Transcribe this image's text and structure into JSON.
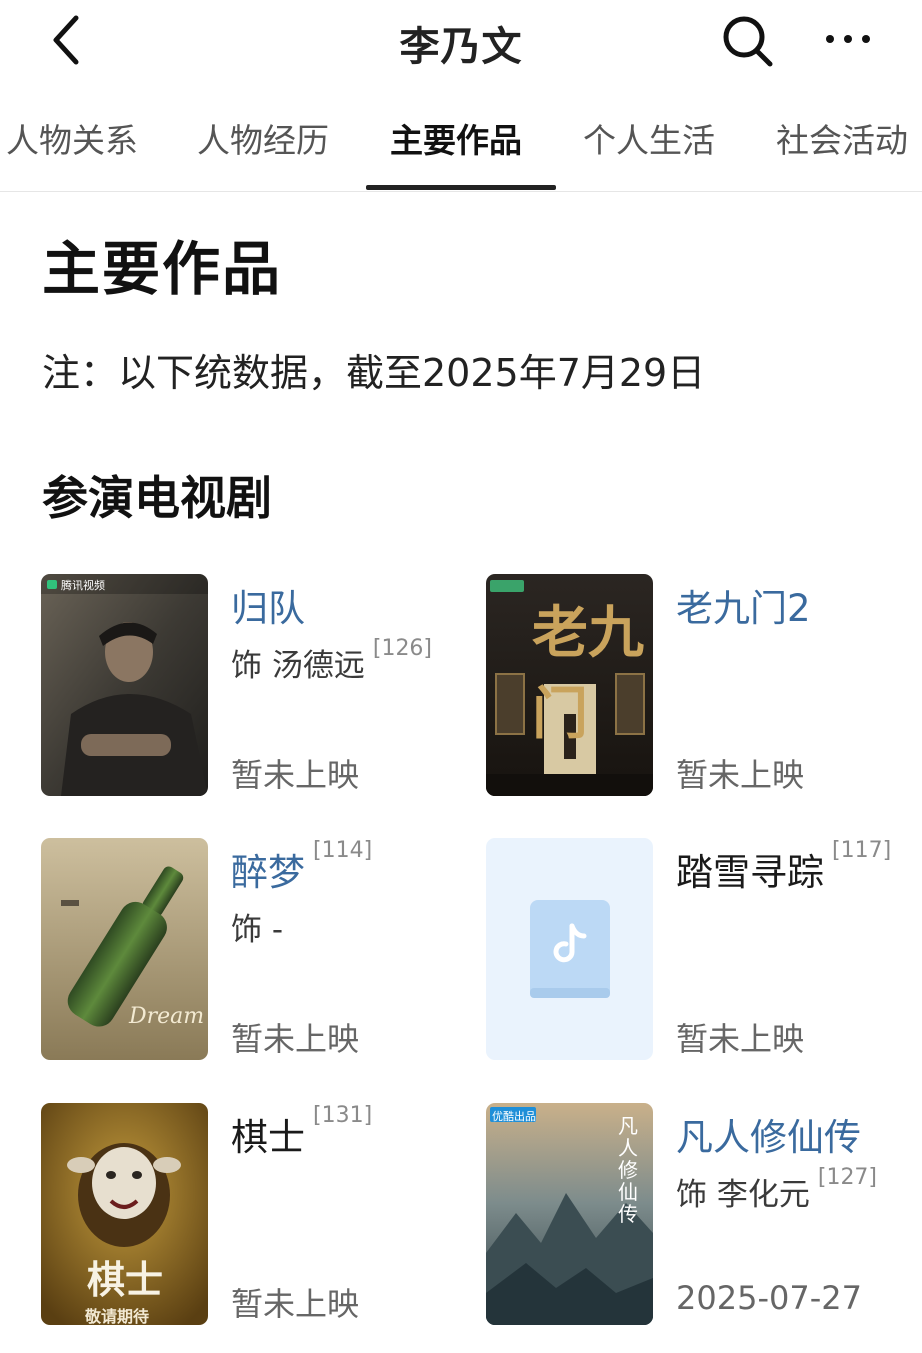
{
  "header": {
    "title": "李乃文"
  },
  "tabs": [
    {
      "label": "人物关系"
    },
    {
      "label": "人物经历"
    },
    {
      "label": "主要作品"
    },
    {
      "label": "个人生活"
    },
    {
      "label": "社会活动"
    }
  ],
  "section": {
    "title": "主要作品",
    "note": "注：以下统数据，截至2025年7月29日",
    "subsection": "参演电视剧"
  },
  "works": [
    {
      "title": "归队",
      "title_ref": "",
      "role": "饰 汤德远",
      "role_ref": "[126]",
      "status": "暂未上映",
      "poster_badge": "腾讯视频"
    },
    {
      "title": "老九门2",
      "title_ref": "",
      "role": "",
      "role_ref": "",
      "status": "暂未上映",
      "poster_text": "老九门"
    },
    {
      "title": "醉梦",
      "title_ref": "[114]",
      "role": "饰 -",
      "role_ref": "",
      "status": "暂未上映",
      "poster_text": "Dream"
    },
    {
      "title": "踏雪寻踪",
      "title_ref": "[117]",
      "role": "",
      "role_ref": "",
      "status": "暂未上映"
    },
    {
      "title": "棋士",
      "title_ref": "[131]",
      "role": "",
      "role_ref": "",
      "status": "暂未上映",
      "poster_text": "棋士",
      "poster_sub": "敬请期待"
    },
    {
      "title": "凡人修仙传",
      "title_ref": "",
      "role": "饰 李化元",
      "role_ref": "[127]",
      "status": "2025-07-27",
      "poster_badge": "优酷出品",
      "poster_text": "凡人修仙传"
    }
  ]
}
